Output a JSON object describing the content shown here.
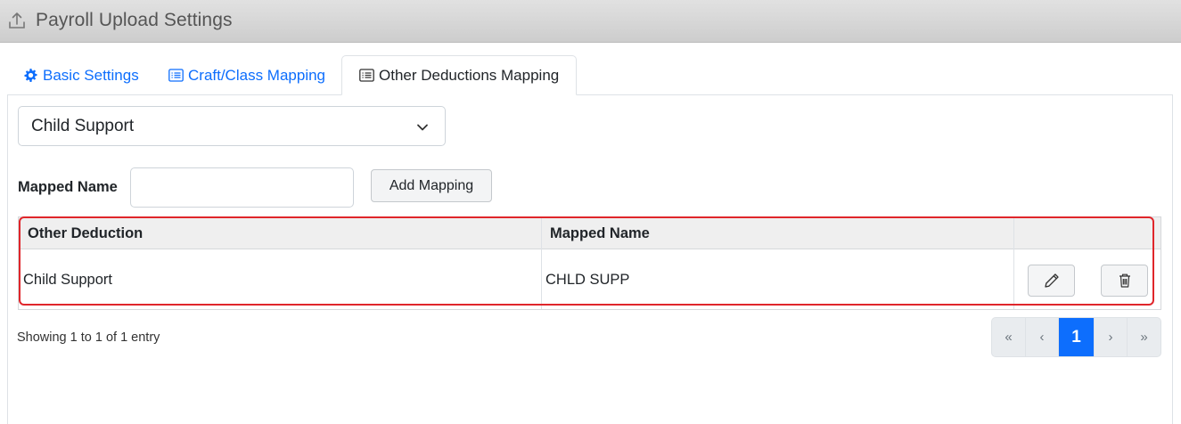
{
  "window": {
    "title": "Payroll Upload Settings",
    "icon": "upload-icon"
  },
  "tabs": [
    {
      "label": "Basic Settings",
      "icon": "gear-icon",
      "active": false
    },
    {
      "label": "Craft/Class Mapping",
      "icon": "list-icon",
      "active": false
    },
    {
      "label": "Other Deductions Mapping",
      "icon": "list-icon",
      "active": true
    }
  ],
  "form": {
    "deduction_select_value": "Child Support",
    "mapped_name_label": "Mapped Name",
    "mapped_name_value": "",
    "add_button_label": "Add Mapping"
  },
  "table": {
    "columns": [
      "Other Deduction",
      "Mapped Name",
      ""
    ],
    "rows": [
      {
        "other_deduction": "Child Support",
        "mapped_name": "CHLD SUPP"
      }
    ],
    "row_actions": [
      "pencil-icon",
      "trash-icon"
    ]
  },
  "footer": {
    "info": "Showing 1 to 1 of 1 entry",
    "pagination": {
      "first": "«",
      "prev": "‹",
      "current": "1",
      "next": "›",
      "last": "»"
    }
  },
  "colors": {
    "accent": "#0d6efd",
    "highlight": "#e0262b",
    "titlebar": "#d6d6d6"
  }
}
